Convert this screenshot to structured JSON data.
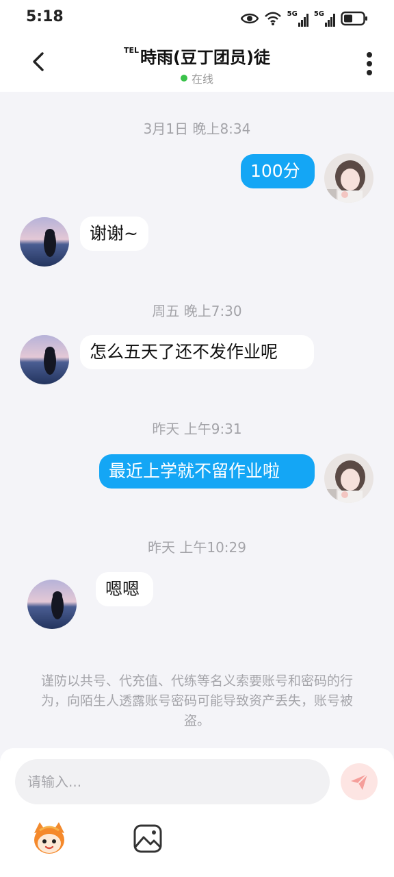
{
  "status_bar": {
    "time": "5:18",
    "icons": [
      "eye-icon",
      "wifi-icon",
      "signal-5g-1-icon",
      "signal-5g-2-icon",
      "battery-icon"
    ],
    "network_label_1": "5G",
    "network_label_2": "5G"
  },
  "header": {
    "tel_badge": "TEL",
    "title": "時雨(豆丁团员)徒",
    "status": "在线",
    "status_color": "#3ac24a"
  },
  "messages": [
    {
      "timestamp": "3月1日 晚上8:34"
    },
    {
      "direction": "out",
      "text": "100分"
    },
    {
      "direction": "in",
      "text": "谢谢~"
    },
    {
      "timestamp": "周五 晚上7:30"
    },
    {
      "direction": "in",
      "text": "怎么五天了还不发作业呢"
    },
    {
      "timestamp": "昨天 上午9:31"
    },
    {
      "direction": "out",
      "text": "最近上学就不留作业啦"
    },
    {
      "timestamp": "昨天 上午10:29"
    },
    {
      "direction": "in",
      "text": "嗯嗯"
    }
  ],
  "notice": "谨防以共号、代充值、代练等名义索要账号和密码的行为，向陌生人透露账号密码可能导致资产丢失，账号被盗。",
  "input": {
    "placeholder": "请输入..."
  },
  "toolbar": {
    "icons": [
      "emoji-mascot-icon",
      "image-icon"
    ]
  },
  "colors": {
    "outgoing_bubble": "#14a6f5",
    "send_button_bg": "#fde5e3",
    "send_icon": "#f59e9a"
  }
}
